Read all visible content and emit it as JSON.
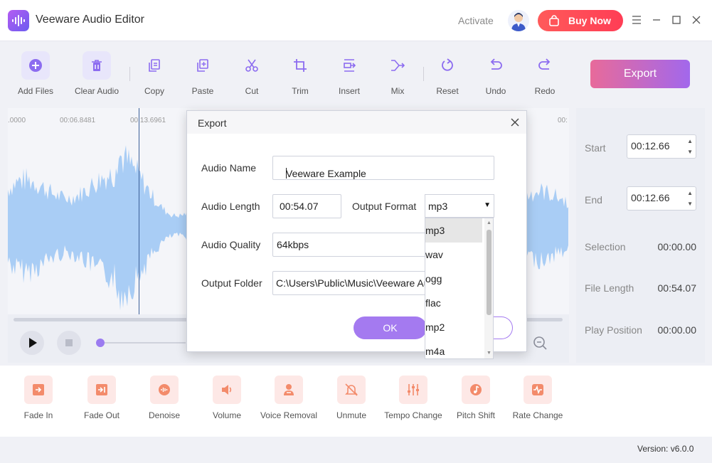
{
  "app": {
    "title": "Veeware Audio Editor",
    "activate": "Activate",
    "buy_now": "Buy Now",
    "version": "Version: v6.0.0"
  },
  "toolbar": [
    {
      "label": "Add Files",
      "icon": "plus-icon"
    },
    {
      "label": "Clear Audio",
      "icon": "trash-icon"
    },
    {
      "label": "Copy",
      "icon": "copy-icon"
    },
    {
      "label": "Paste",
      "icon": "paste-icon"
    },
    {
      "label": "Cut",
      "icon": "scissors-icon"
    },
    {
      "label": "Trim",
      "icon": "crop-icon"
    },
    {
      "label": "Insert",
      "icon": "insert-icon"
    },
    {
      "label": "Mix",
      "icon": "mix-icon"
    },
    {
      "label": "Reset",
      "icon": "reset-icon"
    },
    {
      "label": "Undo",
      "icon": "undo-icon"
    },
    {
      "label": "Redo",
      "icon": "redo-icon"
    }
  ],
  "export_label": "Export",
  "timeline": {
    "ticks": [
      ".0000",
      "00:06.8481",
      "00:13.6961",
      "00:"
    ]
  },
  "info": {
    "start_label": "Start",
    "start_value": "00:12.66",
    "end_label": "End",
    "end_value": "00:12.66",
    "selection_label": "Selection",
    "selection_value": "00:00.00",
    "file_length_label": "File Length",
    "file_length_value": "00:54.07",
    "play_position_label": "Play Position",
    "play_position_value": "00:00.00"
  },
  "effects": [
    {
      "label": "Fade In",
      "icon": "fade-in-icon"
    },
    {
      "label": "Fade Out",
      "icon": "fade-out-icon"
    },
    {
      "label": "Denoise",
      "icon": "denoise-icon"
    },
    {
      "label": "Volume",
      "icon": "volume-icon"
    },
    {
      "label": "Voice Removal",
      "icon": "voice-removal-icon"
    },
    {
      "label": "Unmute",
      "icon": "unmute-icon"
    },
    {
      "label": "Tempo Change",
      "icon": "tempo-icon"
    },
    {
      "label": "Pitch Shift",
      "icon": "pitch-icon"
    },
    {
      "label": "Rate Change",
      "icon": "rate-icon"
    }
  ],
  "dialog": {
    "title": "Export",
    "audio_name_label": "Audio Name",
    "audio_name_value": "Veeware Example",
    "audio_length_label": "Audio Length",
    "audio_length_value": "00:54.07",
    "output_format_label": "Output Format",
    "output_format_value": "mp3",
    "audio_quality_label": "Audio Quality",
    "audio_quality_value": "64kbps",
    "output_folder_label": "Output Folder",
    "output_folder_value": "C:\\Users\\Public\\Music\\Veeware Audio Editor",
    "ok_label": "OK"
  },
  "format_options": [
    "mp3",
    "wav",
    "ogg",
    "flac",
    "mp2",
    "m4a"
  ],
  "colors": {
    "accent": "#a47af0",
    "wave": "#a9cdf5",
    "buy": "#ff4b55"
  }
}
